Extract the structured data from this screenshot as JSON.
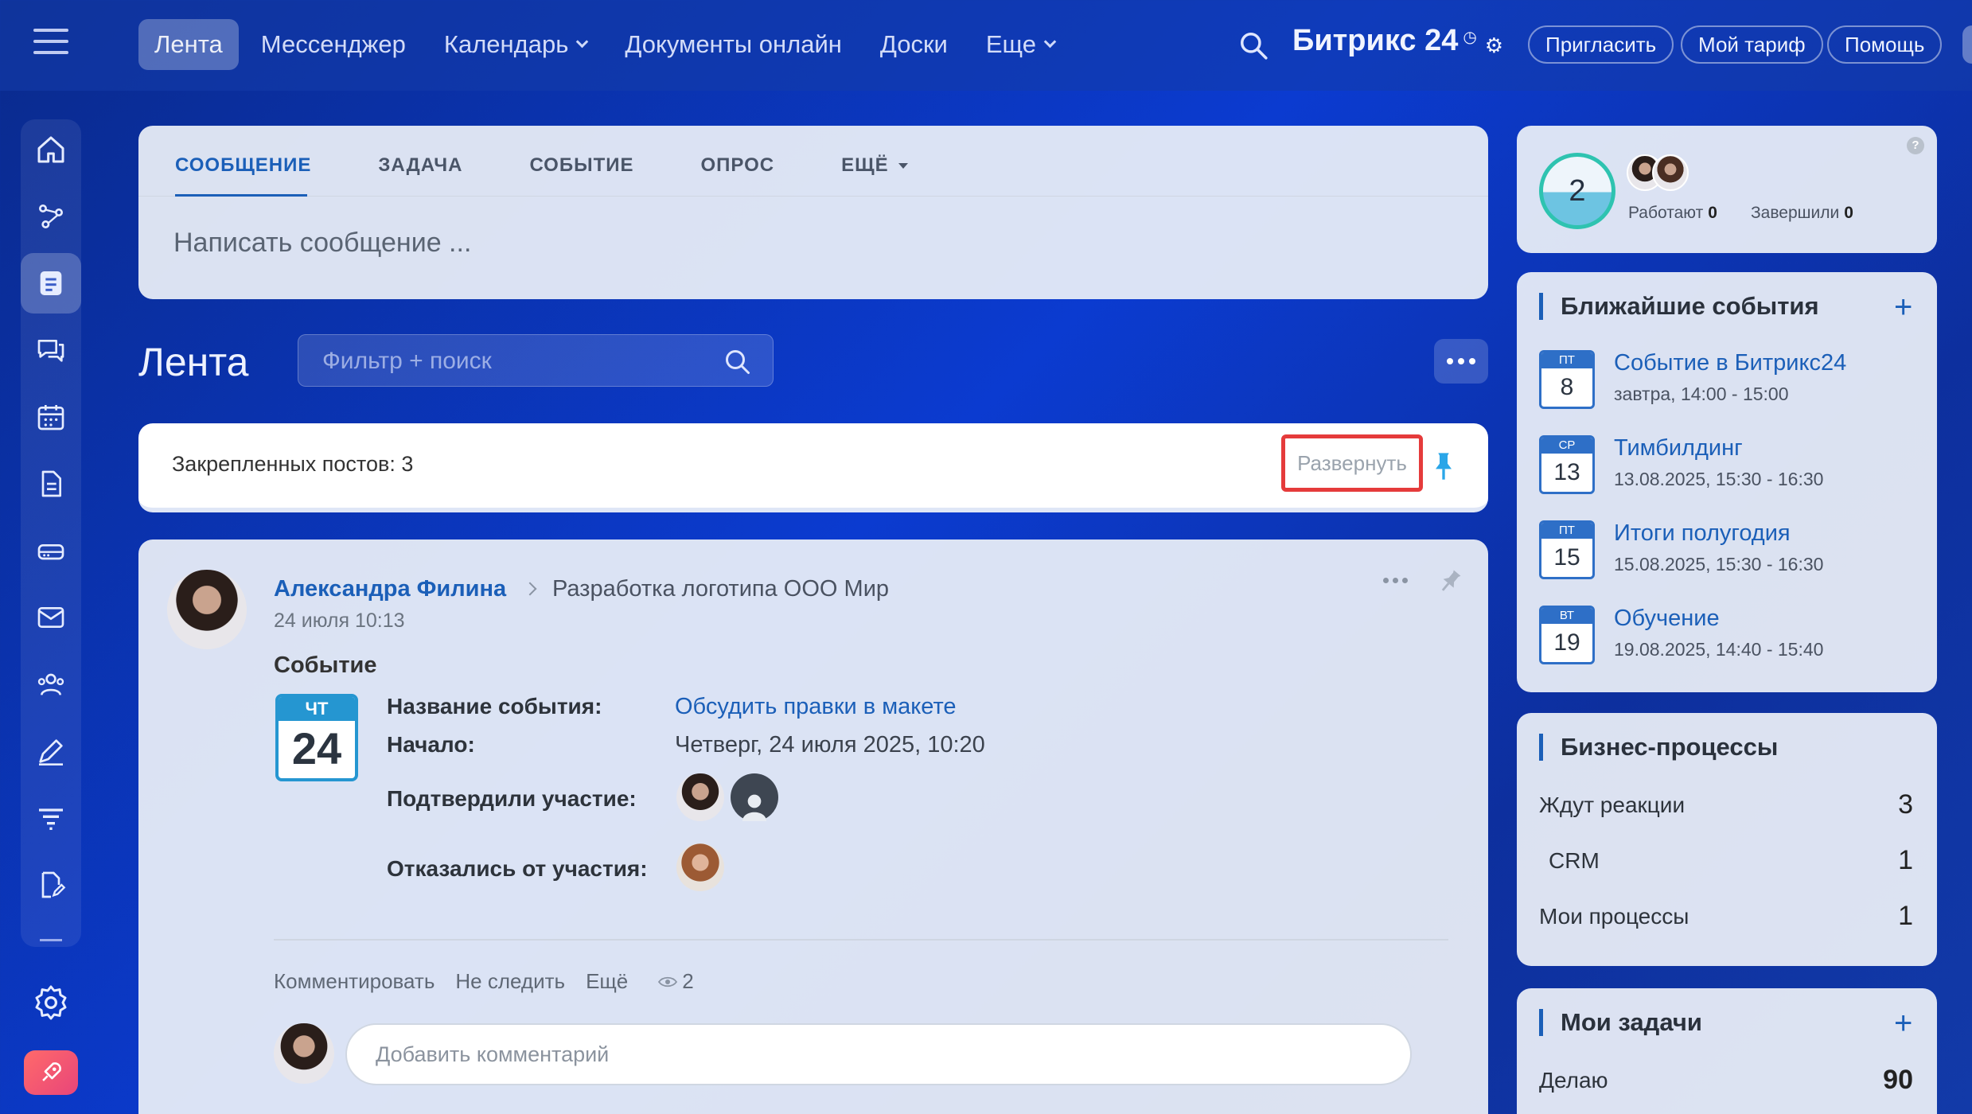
{
  "topbar": {
    "nav": [
      {
        "label": "Лента",
        "active": true,
        "dropdown": false
      },
      {
        "label": "Мессенджер",
        "active": false,
        "dropdown": false
      },
      {
        "label": "Календарь",
        "active": false,
        "dropdown": true
      },
      {
        "label": "Документы онлайн",
        "active": false,
        "dropdown": false
      },
      {
        "label": "Доски",
        "active": false,
        "dropdown": false
      },
      {
        "label": "Еще",
        "active": false,
        "dropdown": true
      }
    ],
    "brand": "Битрикс 24",
    "invite_label": "Пригласить",
    "tariff_label": "Мой тариф",
    "help_label": "Помощь"
  },
  "composer": {
    "tabs": [
      "СООБЩЕНИЕ",
      "ЗАДАЧА",
      "СОБЫТИЕ",
      "ОПРОС",
      "ЕЩЁ"
    ],
    "placeholder": "Написать сообщение ..."
  },
  "feed": {
    "title": "Лента",
    "filter_placeholder": "Фильтр + поиск"
  },
  "pinned": {
    "label": "Закрепленных постов:",
    "count": "3",
    "expand_label": "Развернуть"
  },
  "post": {
    "author": "Александра Филина",
    "destination": "Разработка логотипа ООО Мир",
    "date": "24 июля 10:13",
    "type_title": "Событие",
    "calendar": {
      "weekday": "ЧТ",
      "day": "24"
    },
    "fields": {
      "name_label": "Название события:",
      "name_value": "Обсудить правки в макете",
      "start_label": "Начало:",
      "start_value": "Четверг, 24 июля 2025, 10:20",
      "confirmed_label": "Подтвердили участие:",
      "declined_label": "Отказались от участия:"
    },
    "actions": {
      "comment": "Комментировать",
      "unfollow": "Не следить",
      "more": "Ещё",
      "views": "2"
    },
    "comment_placeholder": "Добавить комментарий"
  },
  "workday": {
    "count": "2",
    "working_label": "Работают",
    "working_count": "0",
    "finished_label": "Завершили",
    "finished_count": "0"
  },
  "events_widget": {
    "title": "Ближайшие события",
    "events": [
      {
        "weekday": "ПТ",
        "day": "8",
        "name": "Событие в Битрикс24",
        "time": "завтра, 14:00 - 15:00"
      },
      {
        "weekday": "СР",
        "day": "13",
        "name": "Тимбилдинг",
        "time": "13.08.2025, 15:30 - 16:30"
      },
      {
        "weekday": "ПТ",
        "day": "15",
        "name": "Итоги полугодия",
        "time": "15.08.2025, 15:30 - 16:30"
      },
      {
        "weekday": "ВТ",
        "day": "19",
        "name": "Обучение",
        "time": "19.08.2025, 14:40 - 15:40"
      }
    ]
  },
  "bp_widget": {
    "title": "Бизнес-процессы",
    "rows": [
      {
        "label": "Ждут реакции",
        "value": "3"
      },
      {
        "label": "CRM",
        "value": "1"
      },
      {
        "label": "Мои процессы",
        "value": "1"
      }
    ]
  },
  "tasks_widget": {
    "title": "Мои задачи",
    "rows": [
      {
        "label": "Делаю",
        "value": "90"
      }
    ]
  },
  "colors": {
    "accent": "#1b5fb8",
    "highlight": "#e53b3b",
    "calendar": "#2596d1"
  }
}
